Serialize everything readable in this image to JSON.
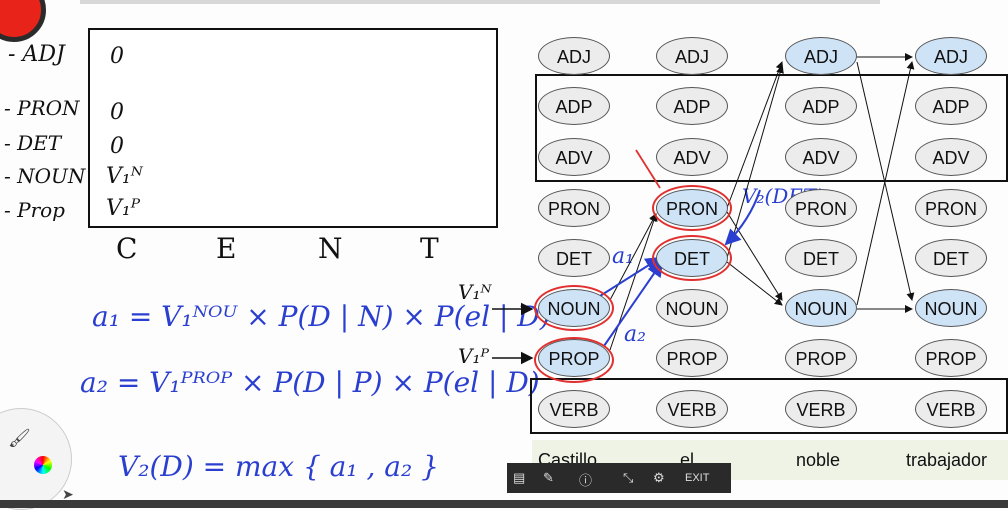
{
  "row_labels": [
    "- ADJ",
    "- PRON",
    "- DET",
    "- NOUN",
    "- Prop"
  ],
  "row_values": [
    "0",
    "0",
    "0",
    "V₁ᴺ",
    "V₁ᴾ"
  ],
  "col_labels": [
    "C",
    "E",
    "N",
    "T"
  ],
  "equations": {
    "a1": "a₁ = V₁ᴺᴼᵁ × P(D | N) × P(el | D)",
    "a2": "a₂ = V₁ᴾᴿᴼᴾ × P(D | P) × P(el | D)",
    "v2": "V₂(D) = max { a₁ , a₂ }"
  },
  "arrow_labels": {
    "vn": "V₁ᴺ",
    "vp": "V₁ᴾ",
    "a1": "a₁",
    "a2": "a₂",
    "v2det": "V₂(DET)"
  },
  "tags": [
    "ADJ",
    "ADP",
    "ADV",
    "PRON",
    "DET",
    "NOUN",
    "PROP",
    "VERB"
  ],
  "words": [
    "Castillo",
    "el",
    "noble",
    "trabajador"
  ],
  "controls": {
    "exit_label": "EXIT"
  }
}
